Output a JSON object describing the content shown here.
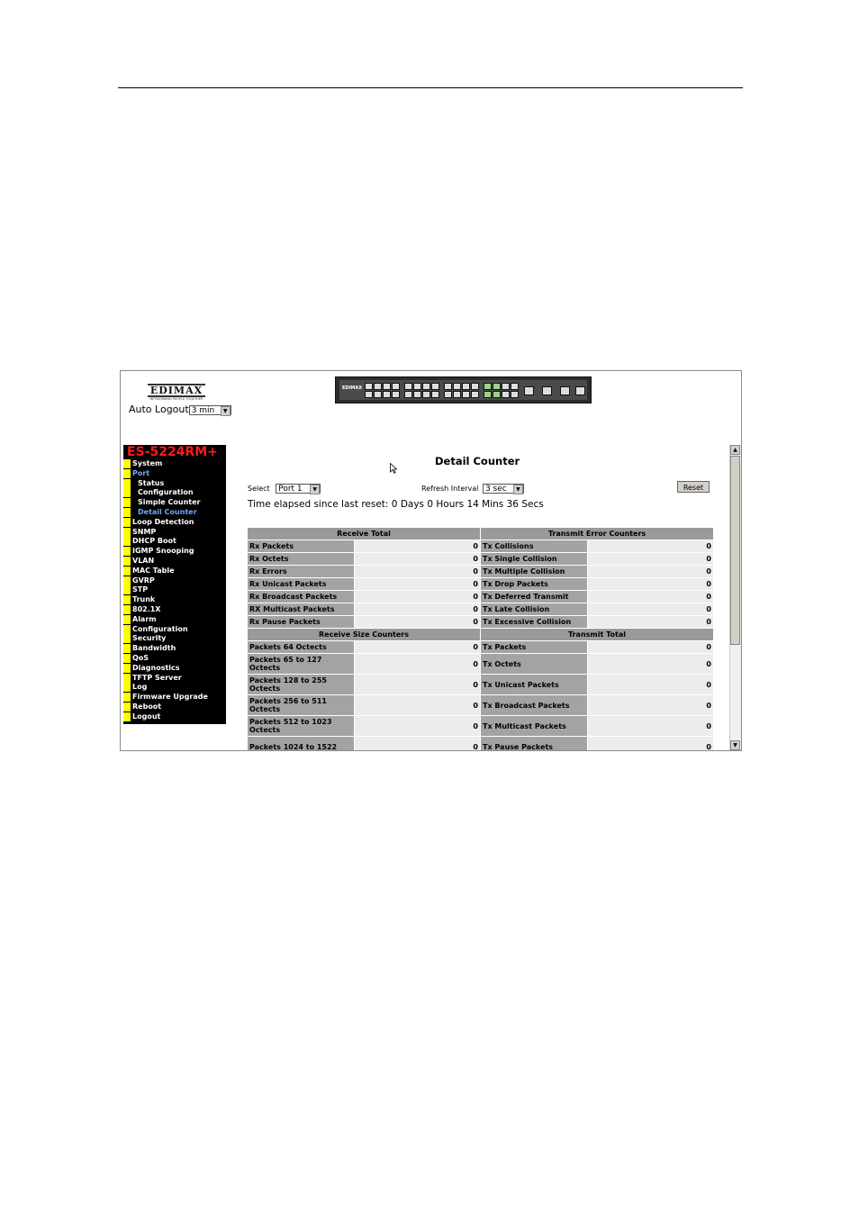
{
  "header": {
    "logo_text": "EDIMAX",
    "logo_tagline": "NETWORKING PEOPLE TOGETHER",
    "auto_logout_label": "Auto Logout",
    "auto_logout_value": "3 min",
    "device_logo": "EDIMAX"
  },
  "sidebar": {
    "model": "ES-5224RM+",
    "items": [
      {
        "label": "System",
        "type": "top"
      },
      {
        "label": "Port",
        "type": "top"
      },
      {
        "label": "Status",
        "type": "sub"
      },
      {
        "label": "Configuration",
        "type": "sub"
      },
      {
        "label": "Simple Counter",
        "type": "sub"
      },
      {
        "label": "Detail Counter",
        "type": "sub-active"
      },
      {
        "label": "Loop Detection",
        "type": "top"
      },
      {
        "label": "SNMP",
        "type": "top"
      },
      {
        "label": "DHCP Boot",
        "type": "top"
      },
      {
        "label": "IGMP Snooping",
        "type": "top"
      },
      {
        "label": "VLAN",
        "type": "top"
      },
      {
        "label": "MAC Table",
        "type": "top"
      },
      {
        "label": "GVRP",
        "type": "top"
      },
      {
        "label": "STP",
        "type": "top"
      },
      {
        "label": "Trunk",
        "type": "top"
      },
      {
        "label": "802.1X",
        "type": "top"
      },
      {
        "label": "Alarm",
        "type": "top"
      },
      {
        "label": "Configuration",
        "type": "top"
      },
      {
        "label": "Security",
        "type": "top"
      },
      {
        "label": "Bandwidth",
        "type": "top"
      },
      {
        "label": "QoS",
        "type": "top"
      },
      {
        "label": "Diagnostics",
        "type": "top"
      },
      {
        "label": "TFTP Server",
        "type": "top"
      },
      {
        "label": "Log",
        "type": "top"
      },
      {
        "label": "Firmware Upgrade",
        "type": "top"
      },
      {
        "label": "Reboot",
        "type": "top"
      },
      {
        "label": "Logout",
        "type": "top"
      }
    ]
  },
  "main": {
    "title": "Detail Counter",
    "select_label": "Select",
    "select_value": "Port 1",
    "refresh_label": "Refresh Interval",
    "refresh_value": "3 sec",
    "reset_label": "Reset",
    "elapsed_text": "Time elapsed since last reset: 0 Days 0 Hours 14 Mins 36 Secs"
  },
  "table": {
    "sections": [
      {
        "left_header": "Receive Total",
        "right_header": "Transmit Error Counters",
        "rows": [
          {
            "l": "Rx Packets",
            "lv": "0",
            "r": "Tx Collisions",
            "rv": "0"
          },
          {
            "l": "Rx Octets",
            "lv": "0",
            "r": "Tx Single Collision",
            "rv": "0"
          },
          {
            "l": "Rx Errors",
            "lv": "0",
            "r": "Tx Multiple Collision",
            "rv": "0"
          },
          {
            "l": "Rx Unicast Packets",
            "lv": "0",
            "r": "Tx Drop Packets",
            "rv": "0"
          },
          {
            "l": "Rx Broadcast Packets",
            "lv": "0",
            "r": "Tx Deferred Transmit",
            "rv": "0"
          },
          {
            "l": "RX Multicast Packets",
            "lv": "0",
            "r": "Tx Late Collision",
            "rv": "0"
          },
          {
            "l": "Rx Pause Packets",
            "lv": "0",
            "r": "Tx Excessive Collision",
            "rv": "0"
          }
        ]
      },
      {
        "left_header": "Receive Size Counters",
        "right_header": "Transmit Total",
        "rows": [
          {
            "l": "Packets 64 Octects",
            "lv": "0",
            "r": "Tx Packets",
            "rv": "0"
          },
          {
            "l": "Packets 65 to 127 Octects",
            "lv": "0",
            "r": "Tx Octets",
            "rv": "0"
          },
          {
            "l": "Packets 128 to 255 Octects",
            "lv": "0",
            "r": "Tx Unicast Packets",
            "rv": "0"
          },
          {
            "l": "Packets 256 to 511 Octects",
            "lv": "0",
            "r": "Tx Broadcast Packets",
            "rv": "0"
          },
          {
            "l": "Packets 512 to 1023 Octects",
            "lv": "0",
            "r": "Tx Multicast Packets",
            "rv": "0"
          },
          {
            "l": "Packets 1024 to 1522",
            "lv": "0",
            "r": "Tx Pause Packets",
            "rv": "0"
          }
        ]
      }
    ]
  }
}
